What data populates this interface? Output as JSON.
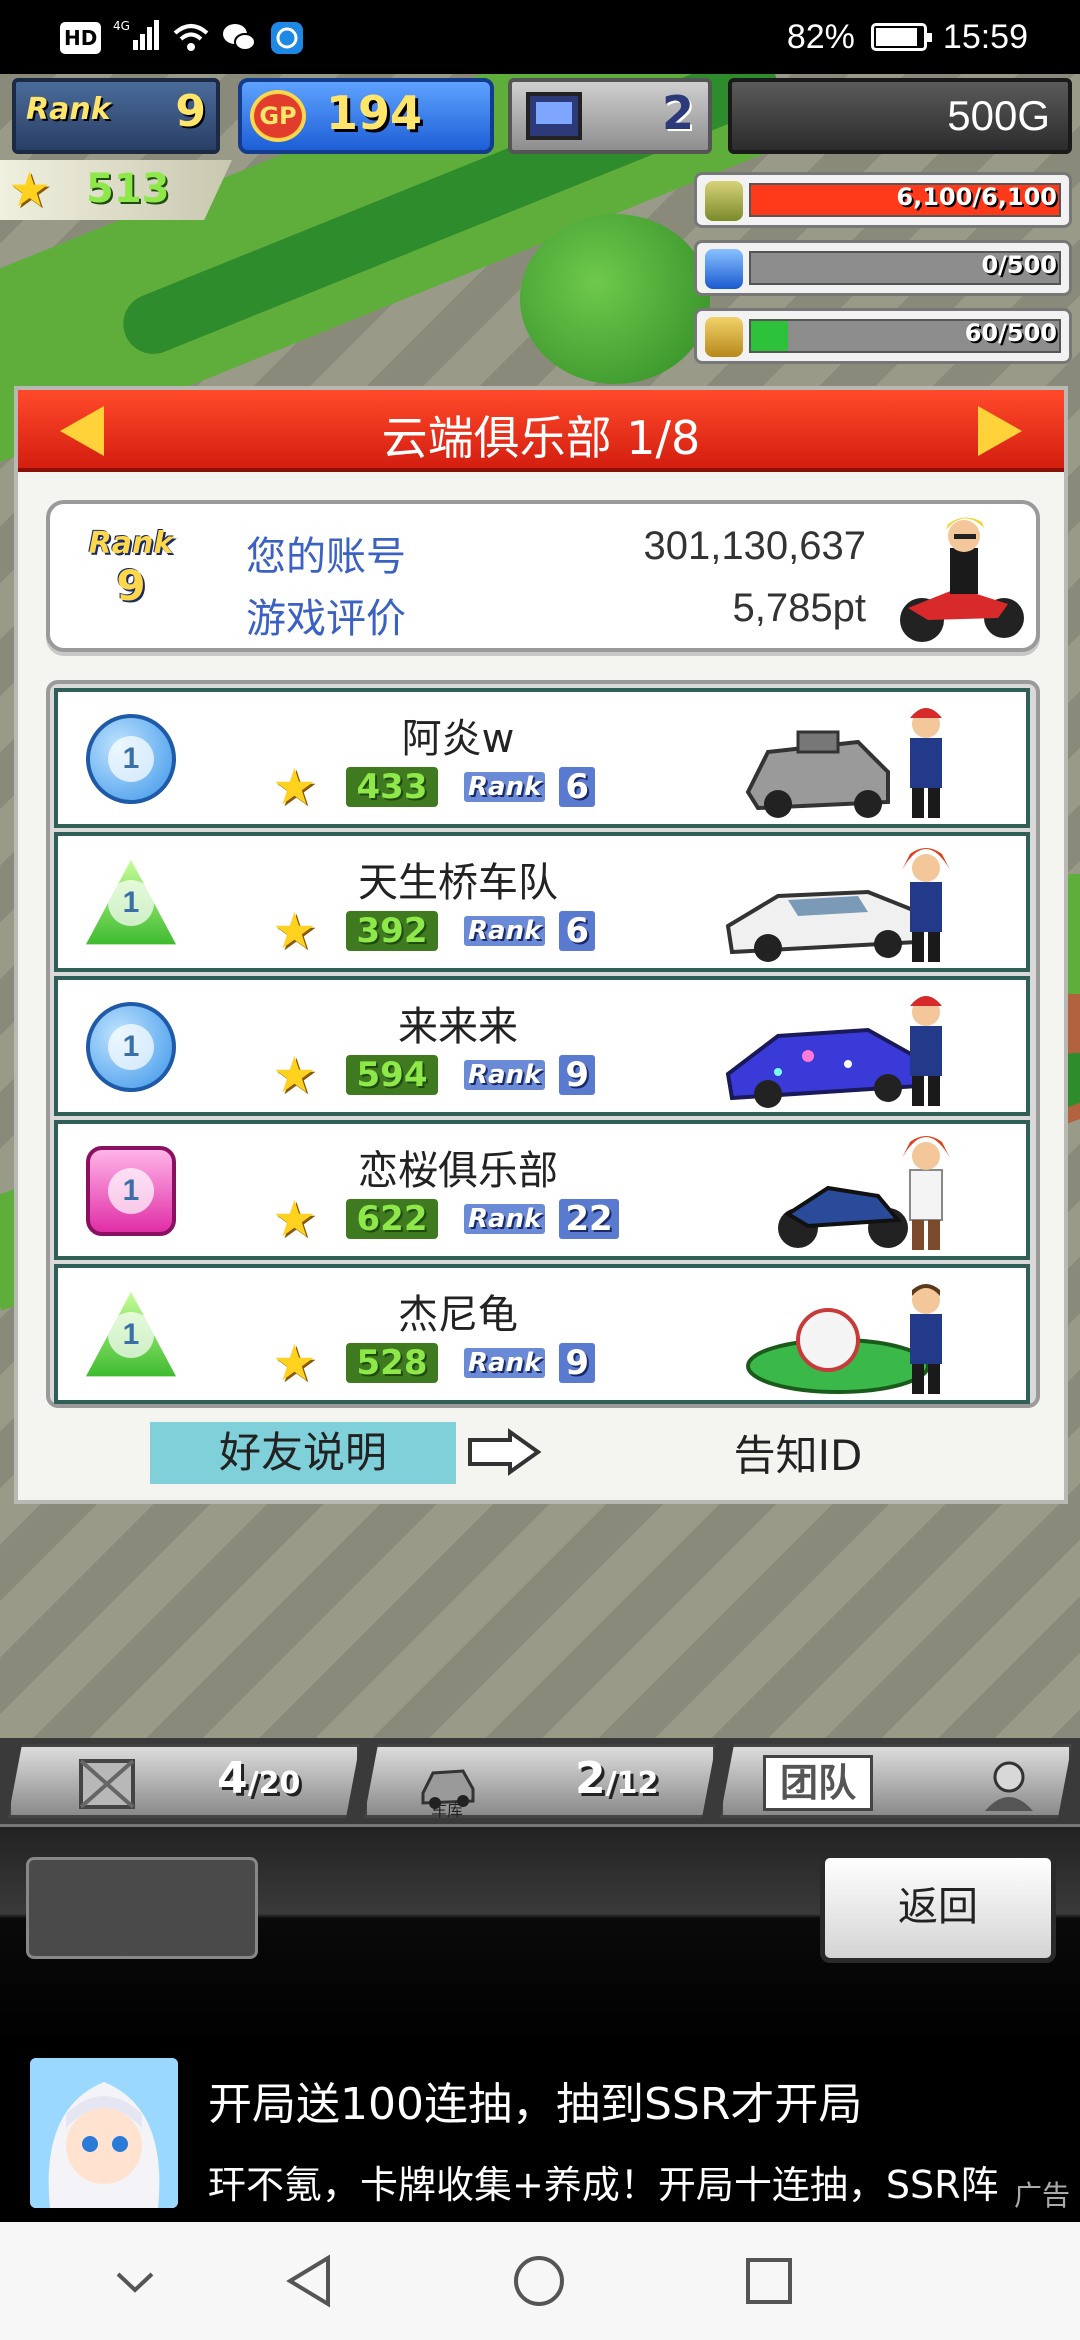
{
  "status_bar": {
    "chip": "HD",
    "network": "4G",
    "battery": "82%",
    "time": "15:59"
  },
  "hud": {
    "rank_label": "Rank",
    "rank_value": "9",
    "gp_label": "GP",
    "gp_value": "194",
    "pc_value": "2",
    "money": "500G",
    "stars": "513"
  },
  "resources": [
    {
      "icon": "fuel-barrel-icon",
      "text": "6,100/6,100",
      "level": 1.0,
      "color": "#ff3a1a"
    },
    {
      "icon": "water-bottle-icon",
      "text": "0/500",
      "level": 0.0,
      "color": "#3a8aff"
    },
    {
      "icon": "wheat-icon",
      "text": "60/500",
      "level": 0.12,
      "color": "#2ec23a"
    }
  ],
  "dialog": {
    "title": "云端俱乐部 1/8",
    "rank_label": "Rank",
    "rank_value": "9",
    "account_label": "您的账号",
    "account_value": "301,130,637",
    "rating_label": "游戏评价",
    "rating_value": "5,785pt"
  },
  "friends": [
    {
      "name": "阿炎w",
      "medal": "circle",
      "medal_text": "1",
      "points": "433",
      "rank_label": "Rank",
      "rank": "6",
      "vehicle_color": "#9a9a9a"
    },
    {
      "name": "天生桥车队",
      "medal": "triangle",
      "medal_text": "1",
      "points": "392",
      "rank_label": "Rank",
      "rank": "6",
      "vehicle_color": "#f0f0f0"
    },
    {
      "name": "来来来",
      "medal": "circle",
      "medal_text": "1",
      "points": "594",
      "rank_label": "Rank",
      "rank": "9",
      "vehicle_color": "#3a3ad8"
    },
    {
      "name": "恋桜俱乐部",
      "medal": "square",
      "medal_text": "1",
      "points": "622",
      "rank_label": "Rank",
      "rank": "22",
      "vehicle_color": "#2a4a9a"
    },
    {
      "name": "杰尼龟",
      "medal": "triangle",
      "medal_text": "1",
      "points": "528",
      "rank_label": "Rank",
      "rank": "9",
      "vehicle_color": "#3ab84a"
    }
  ],
  "buttons": {
    "help": "好友说明",
    "notify_id": "告知ID",
    "back": "返回"
  },
  "tabs": {
    "box_count": "4",
    "box_max": "/20",
    "garage_label": "车库",
    "garage_count": "2",
    "garage_max": "/12",
    "team_label": "团队"
  },
  "ad": {
    "title": "开局送100连抽，抽到SSR才开局",
    "description": "玕不氪，卡牌收集+养成！开局十连抽，SSR阵",
    "tag": "广告"
  }
}
